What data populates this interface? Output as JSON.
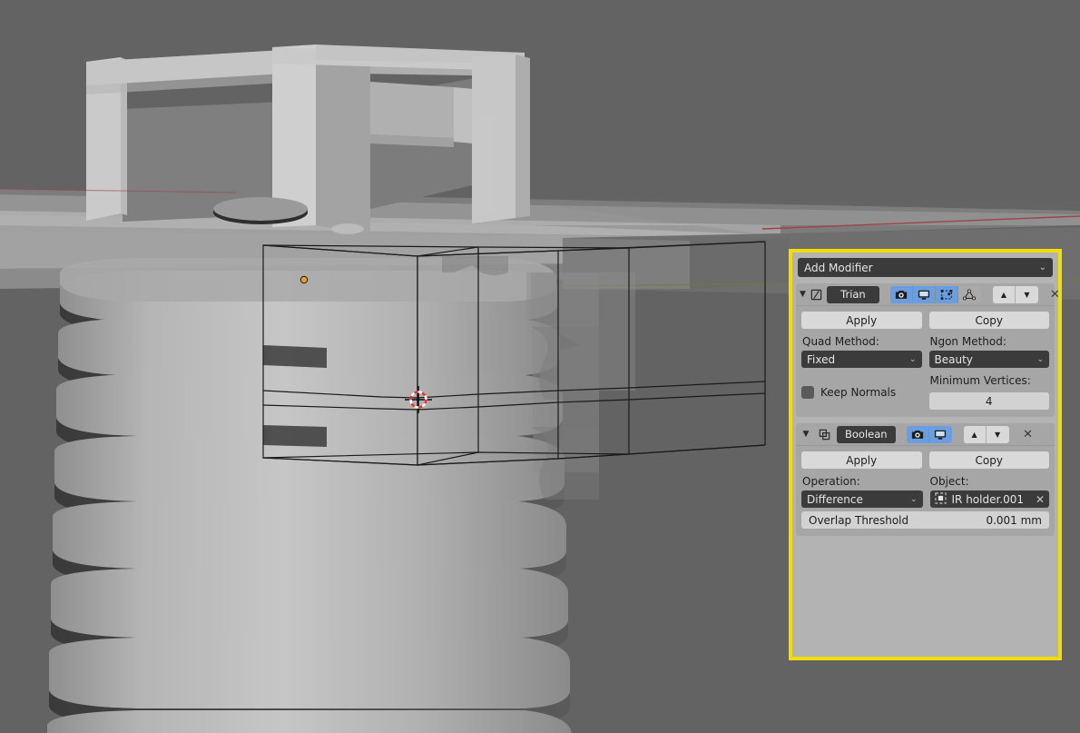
{
  "app": {
    "name": "Blender",
    "viewport": {
      "background_color": "#636363",
      "cursor_name": "3d-cursor",
      "origin_point_name": "object-origin",
      "axis_x_color": "#9e4348",
      "axis_y_color": "#6b7d3f",
      "wireframe_color": "#1a1a1a",
      "object_description": "IR holder bracket with threaded screw boss, bounding wireframe of boolean cutter"
    }
  },
  "properties_panel": {
    "highlight_color": "#f2dd06",
    "background_color": "#b3b3b3",
    "add_modifier": {
      "label": "Add Modifier",
      "icon": "chevron-down-icon",
      "chevron": "⌄"
    },
    "modifiers": [
      {
        "expand_icon": "▼",
        "type_icon": "triangulate-icon",
        "name": "Trian",
        "display_toggles": [
          {
            "icon": "camera-icon",
            "name": "render-toggle",
            "active": true
          },
          {
            "icon": "monitor-icon",
            "name": "realtime-toggle",
            "active": true
          },
          {
            "icon": "edit-mode-icon",
            "name": "edit-mode-toggle",
            "active": true
          },
          {
            "icon": "cage-icon",
            "name": "on-cage-toggle",
            "active": false
          }
        ],
        "move_up": "▲",
        "move_down": "▼",
        "close": "✕",
        "apply_label": "Apply",
        "copy_label": "Copy",
        "fields": {
          "quad_method_label": "Quad Method:",
          "quad_method_value": "Fixed",
          "ngon_method_label": "Ngon Method:",
          "ngon_method_value": "Beauty",
          "keep_normals_label": "Keep Normals",
          "keep_normals_checked": false,
          "minimum_vertices_label": "Minimum Vertices:",
          "minimum_vertices_value": "4",
          "chevron": "⌄"
        }
      },
      {
        "expand_icon": "▼",
        "type_icon": "boolean-icon",
        "name": "Boolean",
        "display_toggles": [
          {
            "icon": "camera-icon",
            "name": "render-toggle",
            "active": true
          },
          {
            "icon": "monitor-icon",
            "name": "realtime-toggle",
            "active": true
          }
        ],
        "move_up": "▲",
        "move_down": "▼",
        "close": "✕",
        "apply_label": "Apply",
        "copy_label": "Copy",
        "fields": {
          "operation_label": "Operation:",
          "operation_value": "Difference",
          "object_label": "Object:",
          "object_value": "IR holder.001",
          "object_icon": "mesh-object-icon",
          "object_clear": "✕",
          "overlap_threshold_label": "Overlap Threshold",
          "overlap_threshold_value": "0.001 mm",
          "chevron": "⌄"
        }
      }
    ]
  }
}
